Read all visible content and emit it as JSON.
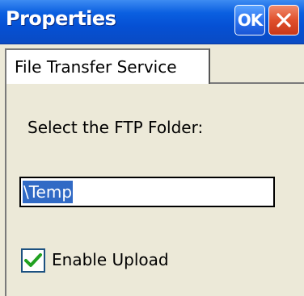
{
  "window": {
    "title": "Properties",
    "ok_label": "OK",
    "close_icon": "close-icon"
  },
  "tabs": [
    {
      "label": "File Transfer Service",
      "selected": true
    }
  ],
  "panel": {
    "prompt": "Select the FTP Folder:",
    "folder_value": "\\Temp",
    "enable_upload_label": "Enable Upload",
    "enable_upload_checked": true
  },
  "colors": {
    "title_bar": "#0550d4",
    "ok_button": "#2b73f0",
    "close_button": "#e0502c",
    "selection": "#316ac5",
    "checkmark": "#21a121"
  }
}
